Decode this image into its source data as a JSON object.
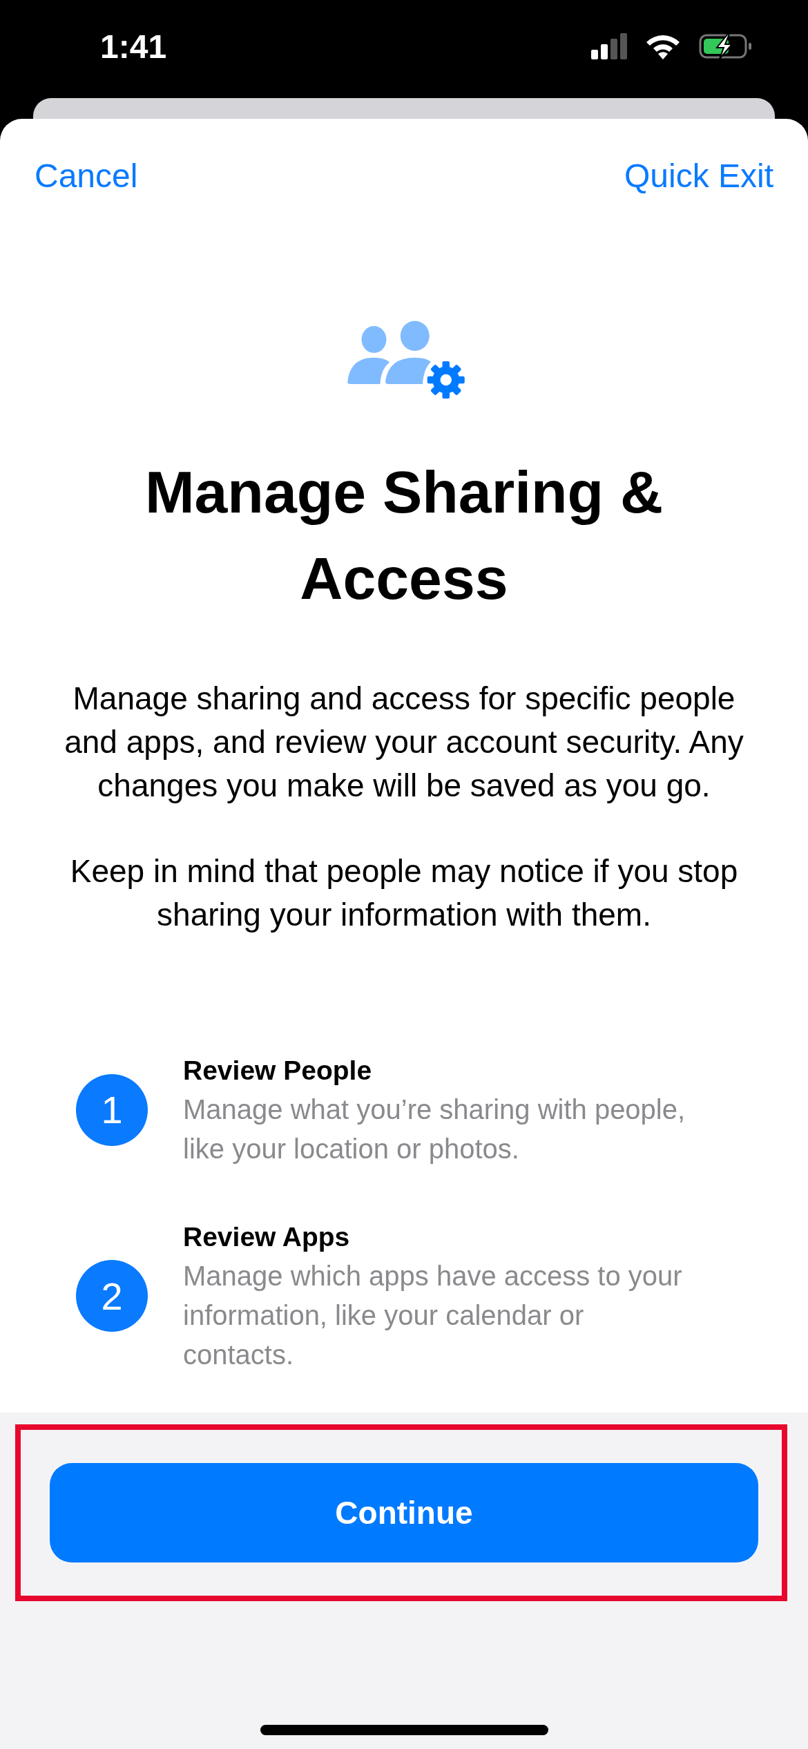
{
  "status_bar": {
    "time": "1:41",
    "battery_charging": true
  },
  "nav": {
    "cancel": "Cancel",
    "quick_exit": "Quick Exit"
  },
  "title": "Manage Sharing & Access",
  "paragraphs": [
    "Manage sharing and access for specific people and apps, and review your account security. Any changes you make will be saved as you go.",
    "Keep in mind that people may notice if you stop sharing your information with them."
  ],
  "steps": [
    {
      "number": "1",
      "title": "Review People",
      "description": "Manage what you’re sharing with people, like your location or photos."
    },
    {
      "number": "2",
      "title": "Review Apps",
      "description": "Manage which apps have access to your information, like your calendar or contacts."
    }
  ],
  "continue_button": {
    "label": "Continue",
    "highlighted": true
  }
}
